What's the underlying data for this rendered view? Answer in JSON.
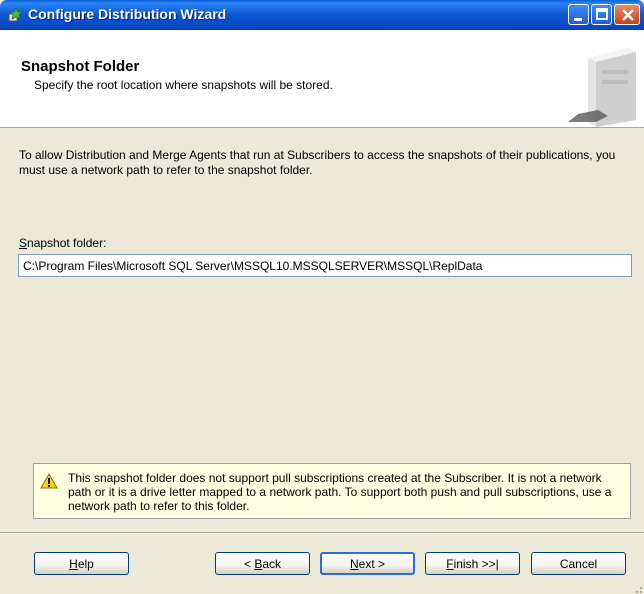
{
  "window": {
    "title": "Configure Distribution Wizard",
    "icon": "wizard-app-icon"
  },
  "header": {
    "title": "Snapshot Folder",
    "subtitle": "Specify the root location where snapshots will be stored.",
    "art": "server-illustration"
  },
  "body": {
    "intro": "To allow Distribution and Merge Agents that run at Subscribers to access the snapshots of their publications, you must use a network path to refer to the snapshot folder.",
    "folder_label_first": "S",
    "folder_label_rest": "napshot folder:",
    "folder_value": "C:\\Program Files\\Microsoft SQL Server\\MSSQL10.MSSQLSERVER\\MSSQL\\ReplData"
  },
  "warning": {
    "icon": "warning-icon",
    "text": "This snapshot folder does not support pull subscriptions created at the Subscriber. It is not a network path or it is a drive letter mapped to a network path. To support both push and pull subscriptions, use a network path to refer to this folder."
  },
  "buttons": {
    "help_key": "H",
    "help_rest": "elp",
    "back_pre": "< ",
    "back_key": "B",
    "back_rest": "ack",
    "next_key": "N",
    "next_rest": "ext >",
    "finish_key": "F",
    "finish_rest": "inish >>|",
    "cancel": "Cancel"
  },
  "colors": {
    "titlebar": "#0c58d4",
    "dialog_bg": "#ece9d8",
    "warning_bg": "#ffffe1",
    "default_button_border": "#2b6ce0"
  }
}
